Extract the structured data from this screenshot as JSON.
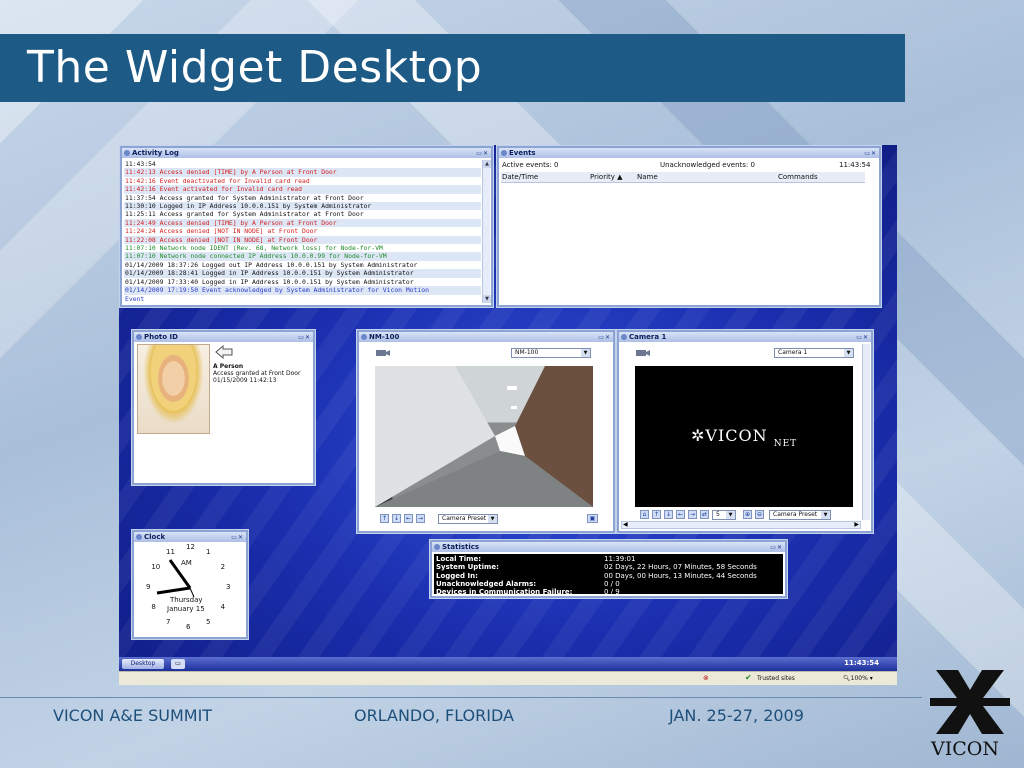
{
  "slide": {
    "title": "The Widget Desktop",
    "footer": {
      "left": "VICON A&E SUMMIT",
      "center": "ORLANDO, FLORIDA",
      "right": "JAN. 25-27, 2009"
    },
    "logo_text": "VICON"
  },
  "activity_log": {
    "title": "Activity Log",
    "lines": [
      {
        "text": "11:43:54",
        "color": "black"
      },
      {
        "text": "11:42:13 Access denied [TIME] by A Person at Front Door",
        "color": "red"
      },
      {
        "text": "11:42:16 Event deactivated for Invalid card read",
        "color": "red"
      },
      {
        "text": "11:42:16 Event activated for Invalid card read",
        "color": "red"
      },
      {
        "text": "11:37:54 Access granted for System Administrator at Front Door",
        "color": "black"
      },
      {
        "text": "11:30:10 Logged in IP Address 10.0.0.151 by System Administrator",
        "color": "black"
      },
      {
        "text": "11:25:11 Access granted for System Administrator at Front Door",
        "color": "black"
      },
      {
        "text": "11:24:49 Access denied [TIME] by A Person at Front Door",
        "color": "red"
      },
      {
        "text": "11:24:24 Access denied [NOT IN NODE] at Front Door",
        "color": "red"
      },
      {
        "text": "11:22:08 Access denied [NOT IN NODE] at Front Door",
        "color": "red"
      },
      {
        "text": "11:07:10 Network node IDENT (Rev. 68, Network loss) for Node-for-VM",
        "color": "green"
      },
      {
        "text": "11:07:10 Network node connected IP Address 10.0.0.99 for Node-for-VM",
        "color": "green"
      },
      {
        "text": "01/14/2009 18:37:26 Logged out IP Address 10.0.0.151 by System Administrator",
        "color": "black"
      },
      {
        "text": "01/14/2009 18:28:41 Logged in IP Address 10.0.0.151 by System Administrator",
        "color": "black"
      },
      {
        "text": "01/14/2009 17:33:40 Logged in IP Address 10.0.0.151 by System Administrator",
        "color": "black"
      },
      {
        "text": "01/14/2009 17:19:50 Event acknowledged by System Administrator for Vicon Motion",
        "color": "blue"
      },
      {
        "text": "Event",
        "color": "blue"
      }
    ]
  },
  "events": {
    "title": "Events",
    "active_label": "Active events: 0",
    "unack_label": "Unacknowledged events: 0",
    "time": "11:43:54",
    "columns": [
      "Date/Time",
      "Priority",
      "Name",
      "Commands"
    ]
  },
  "photo_id": {
    "title": "Photo ID",
    "name": "A Person",
    "detail": "Access granted at Front Door",
    "timestamp": "01/15/2009 11:42:13"
  },
  "nm100": {
    "title": "NM-100",
    "selected_source": "NM-100",
    "preset_label": "Camera Preset"
  },
  "camera1": {
    "title": "Camera 1",
    "selected_source": "Camera 1",
    "logo_main": "VICON",
    "logo_sub": "NET",
    "speed_value": "5",
    "preset_label": "Camera Preset"
  },
  "clock": {
    "title": "Clock",
    "ampm": "AM",
    "day": "Thursday",
    "date": "January 15",
    "numbers": [
      "12",
      "1",
      "2",
      "3",
      "4",
      "5",
      "6",
      "7",
      "8",
      "9",
      "10",
      "11"
    ]
  },
  "statistics": {
    "title": "Statistics",
    "rows": [
      {
        "label": "Local Time:",
        "value": "11:39:01"
      },
      {
        "label": "System Uptime:",
        "value": "02 Days, 22 Hours, 07 Minutes, 58 Seconds"
      },
      {
        "label": "Logged In:",
        "value": "00 Days, 00 Hours, 13 Minutes, 44 Seconds"
      },
      {
        "label": "Unacknowledged Alarms:",
        "value": "0 / 0"
      },
      {
        "label": "Devices in Communication Failure:",
        "value": "0 / 9"
      }
    ]
  },
  "taskbar": {
    "desktop_label": "Desktop",
    "time": "11:43:54",
    "trusted_label": "Trusted sites",
    "zoom_label": "100%"
  }
}
